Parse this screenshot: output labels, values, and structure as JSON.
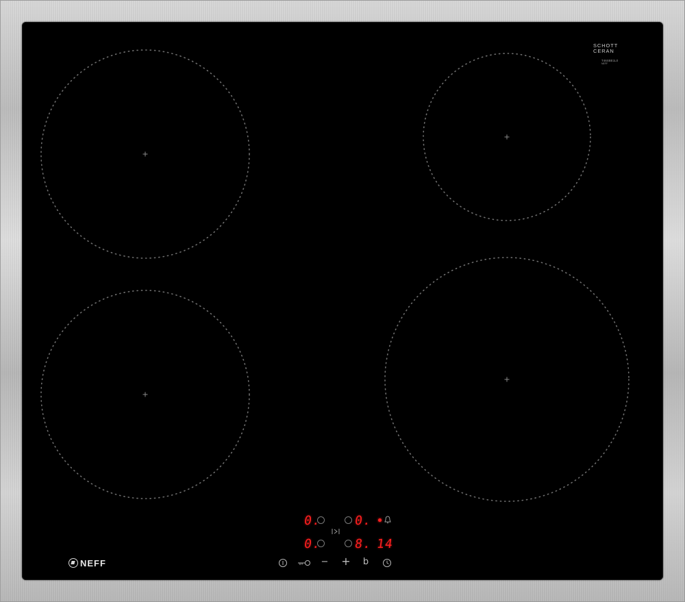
{
  "brand": {
    "schott_line1": "SCHOTT",
    "schott_line2": "CERAN",
    "model_line1": "T46SBE1L0",
    "model_line2": "NEFF",
    "neff_logo": "NEFF"
  },
  "cooking_zones": [
    {
      "name": "zone-front-left"
    },
    {
      "name": "zone-rear-left"
    },
    {
      "name": "zone-rear-right"
    },
    {
      "name": "zone-front-right"
    }
  ],
  "display": {
    "zone_top_left_level": "0.",
    "zone_top_right_level": "0.",
    "zone_bottom_left_level": "0.",
    "zone_bottom_right_level": "8.",
    "timer_value": "14"
  },
  "controls": {
    "power_icon": "power-icon",
    "lock_icon": "child-lock-icon",
    "minus_label": "−",
    "plus_label": "+",
    "boost_label": "b",
    "timer_icon": "timer-icon",
    "zone_select_icon": "zone-select-icon",
    "alarm_icon": "alarm-bell-icon"
  },
  "colors": {
    "glass": "#000000",
    "frame": "#c4c4c4",
    "display_red": "#ff1f1f",
    "zone_marking": "#6e6e6e"
  }
}
